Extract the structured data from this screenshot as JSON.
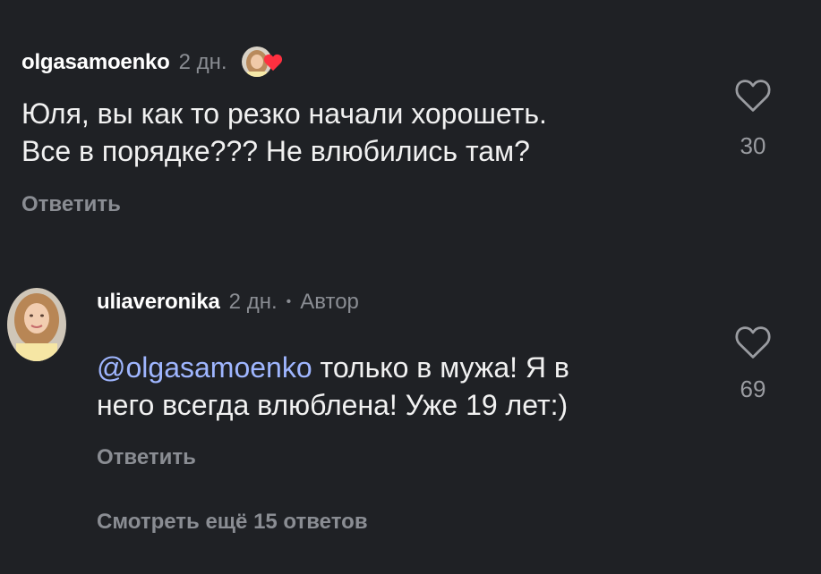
{
  "comment1": {
    "username": "olgasamoenko",
    "time": "2 дн.",
    "text_line1": "Юля, вы как то резко начали хорошеть.",
    "text_line2": "Все в порядке??? Не влюбились там?",
    "reply_label": "Ответить",
    "likes": "30"
  },
  "comment2": {
    "username": "uliaveronika",
    "time": "2 дн.",
    "separator": "•",
    "author_badge": "Автор",
    "mention": "@olgasamoenko",
    "text_rest_line1": " только в мужа! Я в",
    "text_line2": "него всегда влюблена! Уже 19 лет:)",
    "reply_label": "Ответить",
    "likes": "69"
  },
  "more_replies": "Смотреть ещё 15 ответов",
  "colors": {
    "background": "#1f2125",
    "mention": "#9fb6ff",
    "muted": "#8a8d93",
    "heart_red": "#ff3040"
  }
}
